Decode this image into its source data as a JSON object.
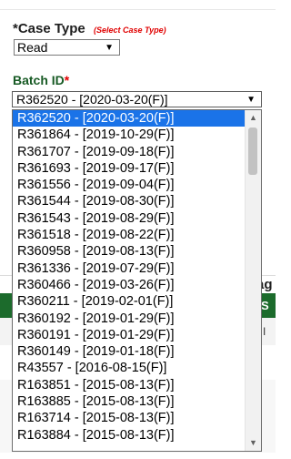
{
  "case_type": {
    "label_prefix": "*",
    "label": "Case Type",
    "hint": "(Select Case Type)",
    "selected": "Read",
    "arrow": "▼"
  },
  "batch": {
    "label": "Batch ID",
    "required": "*",
    "selected": "R362520 - [2020-03-20(F)]",
    "arrow": "▼"
  },
  "dropdown": {
    "items": [
      "R362520 - [2020-03-20(F)]",
      "R361864 - [2019-10-29(F)]",
      "R361707 - [2019-09-18(F)]",
      "R361693 - [2019-09-17(F)]",
      "R361556 - [2019-09-04(F)]",
      "R361544 - [2019-08-30(F)]",
      "R361543 - [2019-08-29(F)]",
      "R361518 - [2019-08-22(F)]",
      "R360958 - [2019-08-13(F)]",
      "R361336 - [2019-07-29(F)]",
      "R360466 - [2019-03-26(F)]",
      "R360211 - [2019-02-01(F)]",
      "R360192 - [2019-01-29(F)]",
      "R360191 - [2019-01-29(F)]",
      "R360149 - [2019-01-18(F)]",
      "R43557 - [2016-08-15(F)]",
      "R163851 - [2015-08-13(F)]",
      "R163885 - [2015-08-13(F)]",
      "R163714 - [2015-08-13(F)]",
      "R163884 - [2015-08-13(F)]"
    ],
    "scroll_up": "▲",
    "scroll_down": "▼"
  },
  "background": {
    "paren": ")",
    "heading_fragment": "ag",
    "table_header_fragment": "S",
    "row_fragment": "I"
  },
  "colors": {
    "required": "#e00000",
    "batch_label": "#175a24",
    "highlight": "#1a73e8",
    "table_header": "#1c6b2c"
  }
}
